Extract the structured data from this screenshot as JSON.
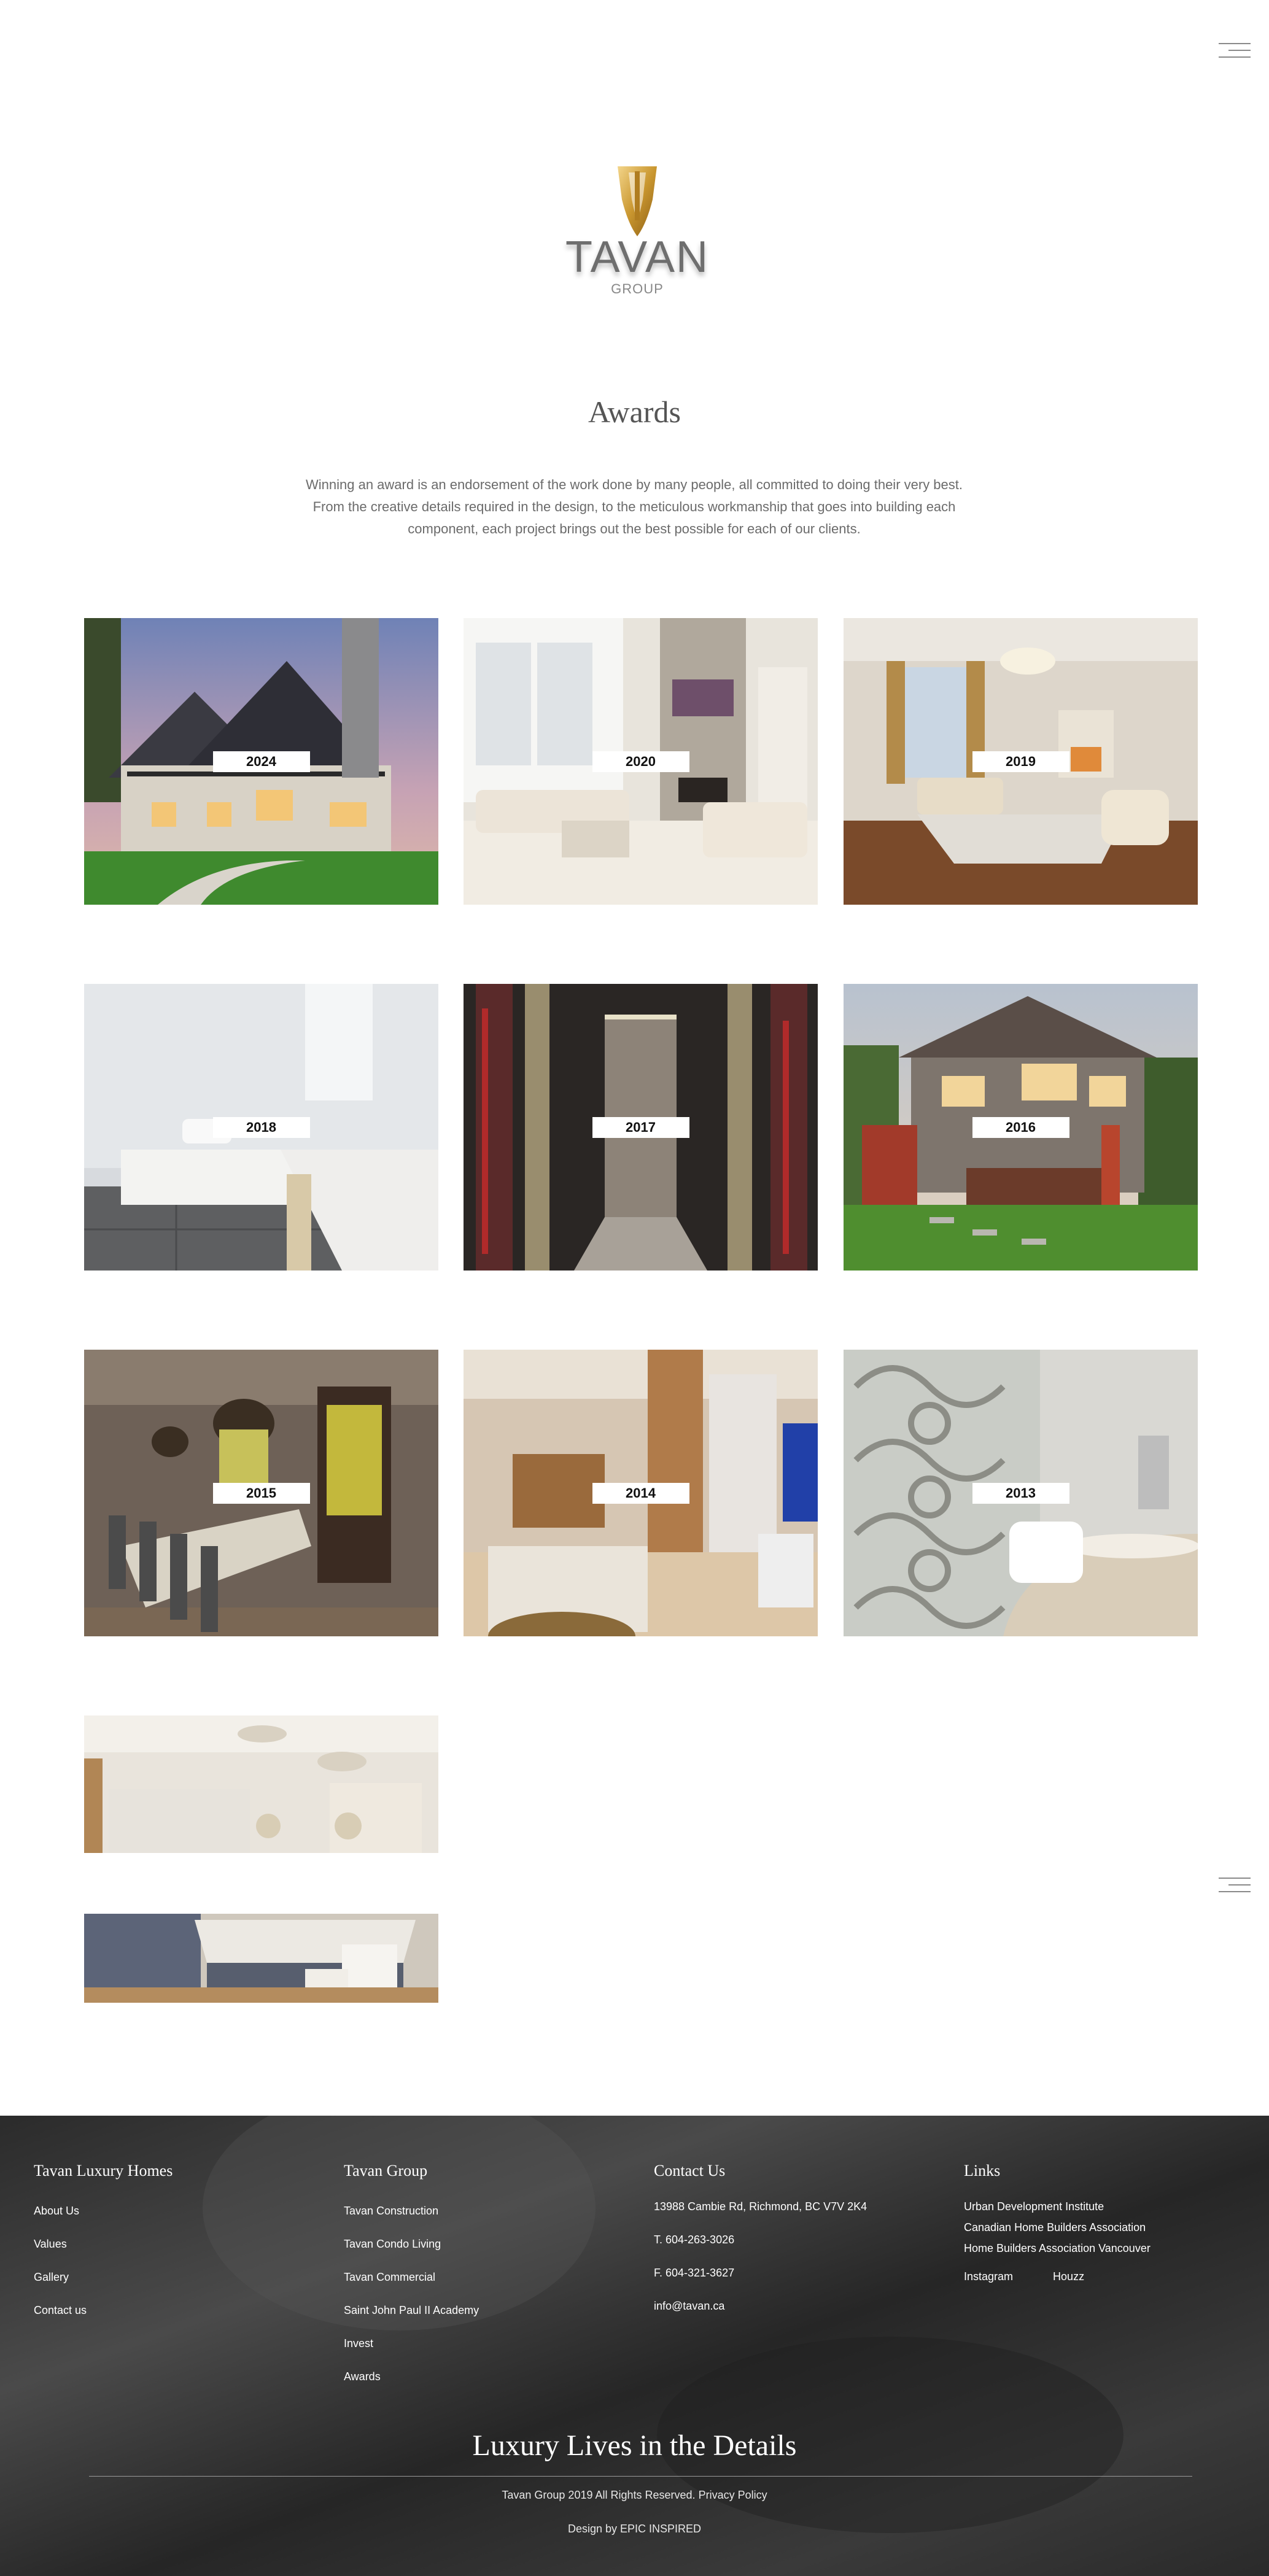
{
  "header": {
    "brand": "TAVAN",
    "brand_sub": "GROUP",
    "menu_icon": "hamburger-menu-icon"
  },
  "page": {
    "title": "Awards",
    "intro": "Winning an award is an endorsement of the work done by many people, all committed to doing their very best. From the creative details required in the design, to the meticulous workmanship that goes into building each component, each project brings out the best possible for each of our clients."
  },
  "awards": [
    {
      "year": "2024"
    },
    {
      "year": "2020"
    },
    {
      "year": "2019"
    },
    {
      "year": "2018"
    },
    {
      "year": "2017"
    },
    {
      "year": "2016"
    },
    {
      "year": "2015"
    },
    {
      "year": "2014"
    },
    {
      "year": "2013"
    }
  ],
  "footer": {
    "col1": {
      "heading": "Tavan Luxury Homes",
      "links": [
        "About Us",
        "Values",
        "Gallery",
        "Contact us"
      ]
    },
    "col2": {
      "heading": "Tavan Group",
      "links": [
        "Tavan Construction",
        "Tavan Condo Living",
        "Tavan Commercial",
        "Saint John Paul II Academy",
        "Invest",
        "Awards"
      ]
    },
    "col3": {
      "heading": "Contact Us",
      "address": "13988 Cambie Rd, Richmond, BC V7V 2K4",
      "phone": "T. 604-263-3026",
      "fax": "F. 604-321-3627",
      "email": "info@tavan.ca"
    },
    "col4": {
      "heading": "Links",
      "links": [
        "Urban Development Institute",
        "Canadian Home Builders Association",
        "Home Builders Association Vancouver"
      ],
      "social": [
        "Instagram",
        "Houzz"
      ]
    },
    "tagline": "Luxury Lives in the Details",
    "copyright": "Tavan Group 2019 All Rights Reserved.",
    "privacy": "Privacy Policy",
    "design_credit": "Design by EPIC INSPIRED"
  }
}
